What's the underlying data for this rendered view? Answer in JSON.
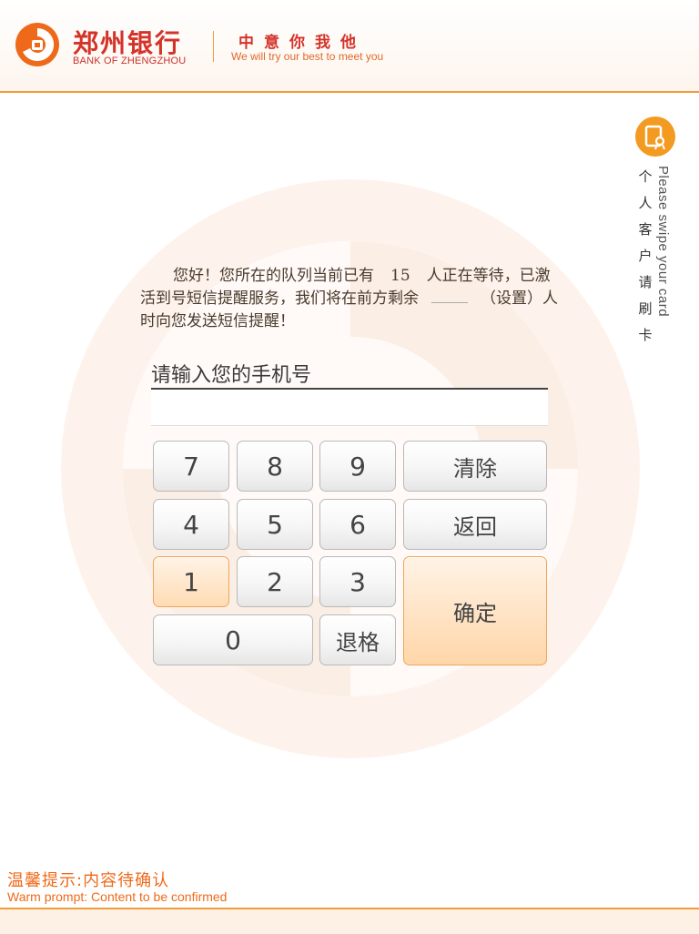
{
  "header": {
    "bank_name_cn": "郑州银行",
    "bank_name_en": "BANK OF ZHENGZHOU",
    "slogan_cn": "中意你我他",
    "slogan_en": "We will try our best to meet you"
  },
  "side": {
    "icon": "card-swipe-icon",
    "label_cn": [
      "个",
      "人",
      "客",
      "户",
      "请",
      "刷",
      "卡"
    ],
    "label_en": "Please swipe your card"
  },
  "message": {
    "part1": "您好！您所在的队列当前已有",
    "queue_count": "15",
    "part2": "人正在等待，已激活到号短信提醒服务，我们将在前方剩余",
    "remaining_value": "",
    "part3": "（设置）人时向您发送短信提醒！"
  },
  "phone_input": {
    "label": "请输入您的手机号",
    "value": ""
  },
  "keypad": {
    "k7": "7",
    "k8": "8",
    "k9": "9",
    "clear": "清除",
    "k4": "4",
    "k5": "5",
    "k6": "6",
    "back": "返回",
    "k1": "1",
    "k2": "2",
    "k3": "3",
    "confirm": "确定",
    "k0": "0",
    "backspace": "退格"
  },
  "footer": {
    "prompt_cn": "温馨提示:内容待确认",
    "prompt_en": "Warm prompt: Content to be confirmed"
  },
  "colors": {
    "brand_red": "#d4332a",
    "accent_orange": "#f39a3a",
    "prompt_orange": "#ee6a1a",
    "active_key": "#ffdcb4"
  }
}
